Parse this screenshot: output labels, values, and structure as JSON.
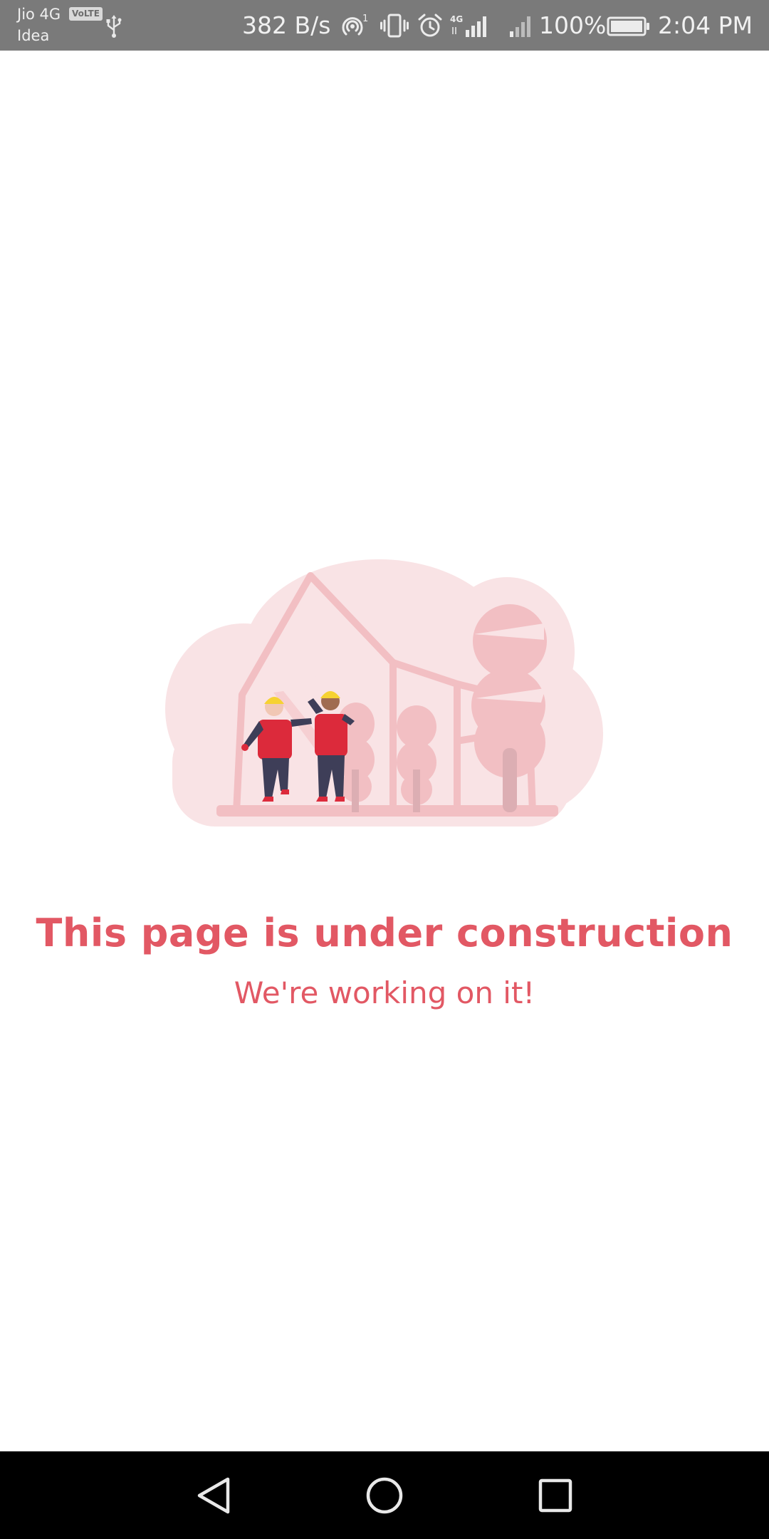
{
  "status_bar": {
    "carrier_primary": "Jio 4G",
    "volte_badge": "VoLTE",
    "carrier_secondary": "Idea",
    "network_speed": "382 B/s",
    "hotspot_count": "1",
    "network_type": "4G",
    "battery_percent": "100%",
    "time": "2:04 PM",
    "icons": [
      "usb-icon",
      "hotspot-icon",
      "vibrate-icon",
      "alarm-icon",
      "signal-icon",
      "signal-icon",
      "battery-icon"
    ]
  },
  "main": {
    "illustration": "under-construction-illustration",
    "title": "This page is under construction",
    "subtitle": "We're working on it!"
  },
  "nav_bar": {
    "icons": [
      "back-icon",
      "home-icon",
      "recents-icon"
    ]
  },
  "colors": {
    "accent": "#e25864",
    "status_bar": "#7a7a7a",
    "nav_bar": "#000000",
    "illustration_pink": "#f4c3c7"
  }
}
